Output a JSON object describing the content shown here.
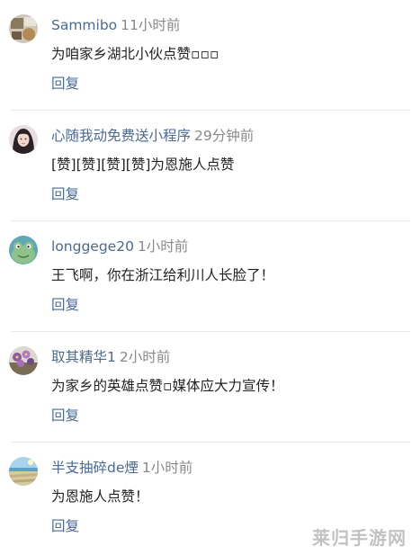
{
  "comments": [
    {
      "name": "Sammibo",
      "time": "11小时前",
      "text": "为咱家乡湖北小伙点赞▫▫▫",
      "reply": "回复",
      "avatar_icon": "avatar-food-photo"
    },
    {
      "name": "心随我动免费送小程序",
      "time": "29分钟前",
      "text": "[赞][赞][赞][赞]为恩施人点赞",
      "reply": "回复",
      "avatar_icon": "avatar-girl-photo"
    },
    {
      "name": "longgege20",
      "time": "1小时前",
      "text": "王飞啊，你在浙江给利川人长脸了！",
      "reply": "回复",
      "avatar_icon": "avatar-frog-cartoon"
    },
    {
      "name": "取其精华1",
      "time": "2小时前",
      "text": "为家乡的英雄点赞▫媒体应大力宣传！",
      "reply": "回复",
      "avatar_icon": "avatar-flowers-photo"
    },
    {
      "name": "半支抽碎de煙",
      "time": "1小时前",
      "text": "为恩施人点赞！",
      "reply": "回复",
      "avatar_icon": "avatar-landscape-photo"
    }
  ],
  "watermark": "莱归手游网",
  "colors": {
    "name": "#4a6a94",
    "time": "#888888",
    "text": "#222222",
    "divider": "#e8e8e8"
  }
}
